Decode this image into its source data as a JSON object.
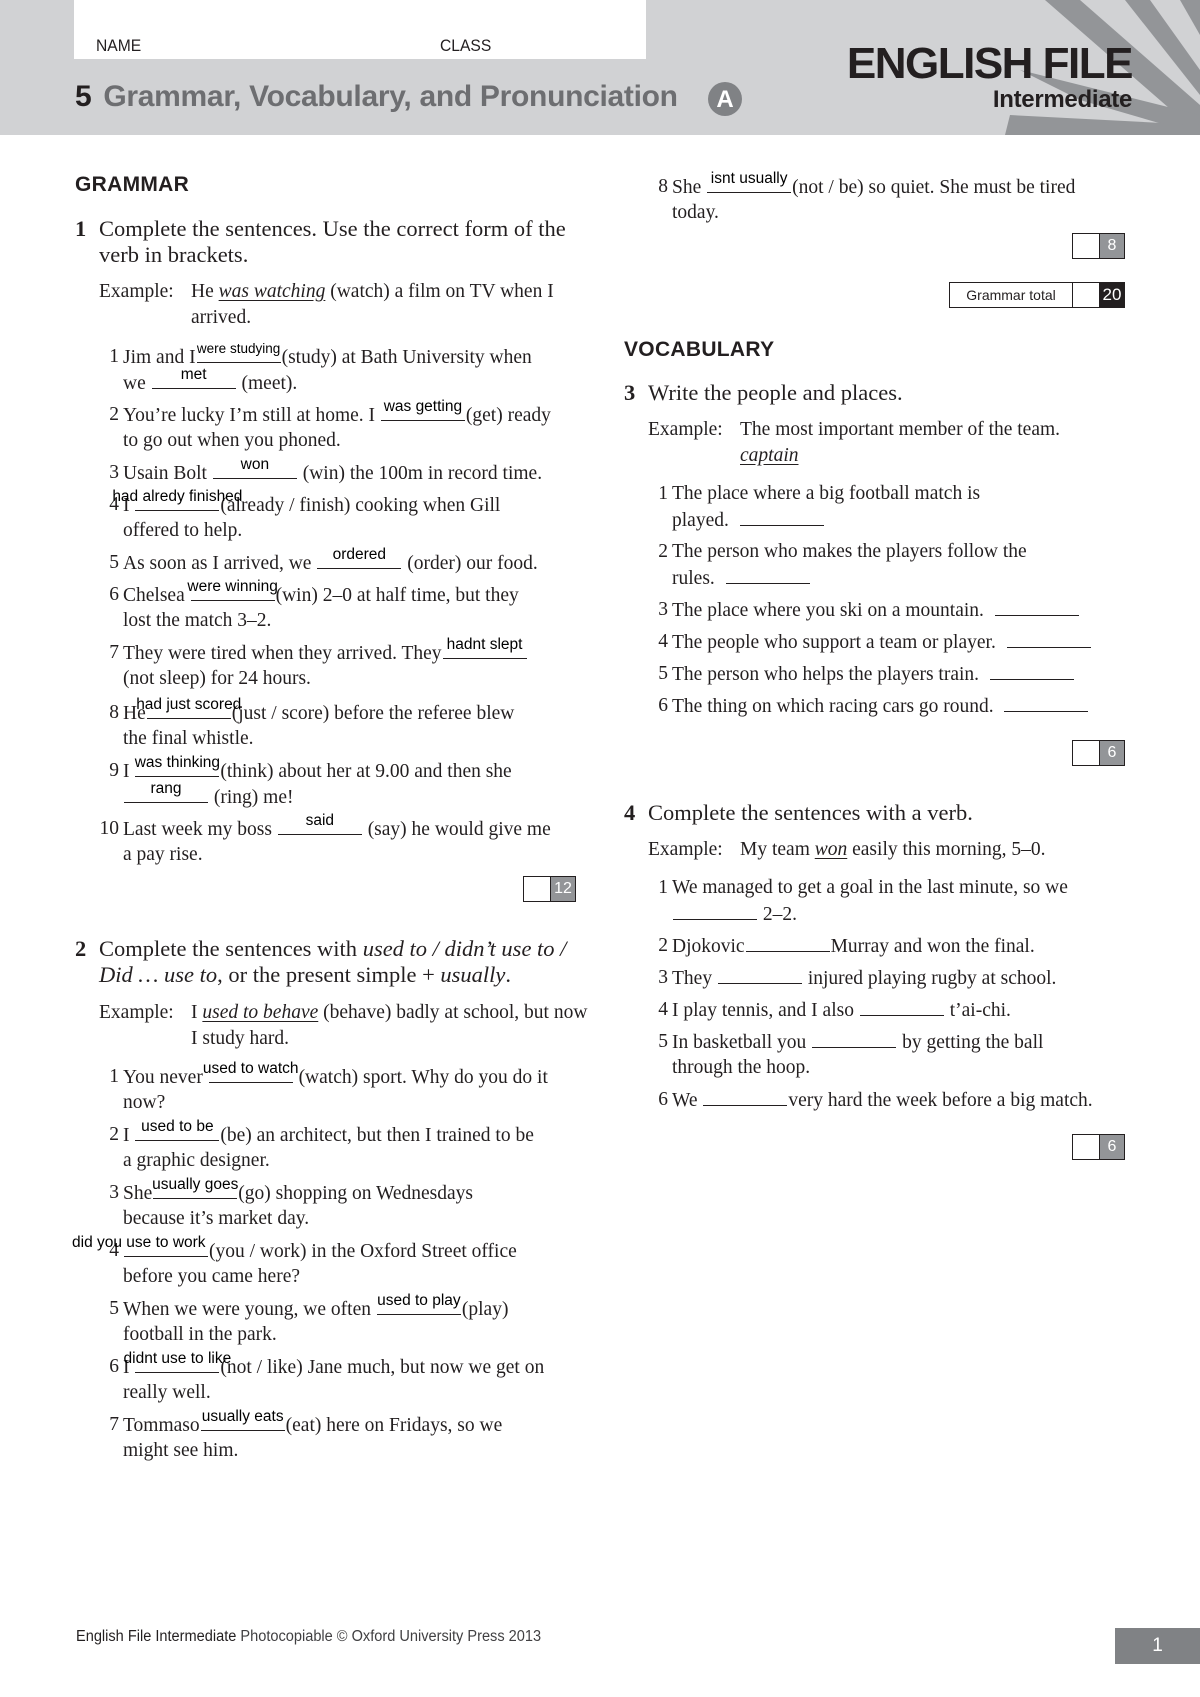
{
  "header": {
    "name_label": "NAME",
    "class_label": "CLASS",
    "unit_number": "5",
    "unit_title": "Grammar, Vocabulary, and Pronunciation",
    "version": "A",
    "brand": "ENGLISH FILE",
    "level": "Intermediate"
  },
  "grammar": {
    "heading": "GRAMMAR",
    "ex1": {
      "number": "1",
      "instruction": "Complete the sentences. Use the correct form of the verb in brackets.",
      "example_label": "Example:",
      "example_pre": "He ",
      "example_answer": "was watching",
      "example_post": " (watch) a film on TV when I arrived.",
      "items": [
        {
          "n": "1",
          "a": "Jim and I",
          "ans1": "were studying",
          "b": "(study) at Bath University when",
          "c": "we",
          "ans2": "met",
          "d": "(meet)."
        },
        {
          "n": "2",
          "a": "You’re lucky I’m still at home. I",
          "ans1": "was getting",
          "b": "(get) ready",
          "c": "to go out when you phoned."
        },
        {
          "n": "3",
          "a": "Usain Bolt",
          "ans1": "won",
          "b": "(win) the 100m in record time."
        },
        {
          "n": "4",
          "a": "I",
          "ans1": "had alredy finished",
          "b": "(already / finish) cooking when Gill",
          "c": "offered to help."
        },
        {
          "n": "5",
          "a": "As soon as I arrived, we",
          "ans1": "ordered",
          "b": "(order) our food."
        },
        {
          "n": "6",
          "a": "Chelsea",
          "ans1": "were winning",
          "b": "(win) 2–0 at half time, but they",
          "c": "lost the match 3–2."
        },
        {
          "n": "7",
          "a": "They were tired when they arrived. They",
          "ans1": "hadnt slept",
          "c": "(not sleep) for 24 hours."
        },
        {
          "n": "8",
          "a": "He",
          "ans1": "had just scored",
          "b": "(just / score) before the referee blew",
          "c": "the final whistle."
        },
        {
          "n": "9",
          "a": "I",
          "ans1": "was thinking",
          "b": "(think) about her at 9.00 and then she",
          "ans2": "rang",
          "d": "(ring) me!"
        },
        {
          "n": "10",
          "a": "Last week my boss",
          "ans1": "said",
          "b": "(say) he would give me",
          "c": "a pay rise."
        }
      ],
      "max_score": "12"
    },
    "ex2": {
      "number": "2",
      "instruction_pre": "Complete the sentences with ",
      "instruction_italic1": "used to / didn’t use to /",
      "instruction_italic2": "Did … use to",
      "instruction_mid": ", or the present simple + ",
      "instruction_italic3": "usually",
      "instruction_end": ".",
      "example_label": "Example:",
      "example_pre": "I ",
      "example_answer": "used to behave",
      "example_post": " (behave) badly at school, but now I study hard.",
      "items": [
        {
          "n": "1",
          "a": "You never",
          "ans1": "used to watch",
          "b": "(watch) sport. Why do you do it",
          "c": "now?"
        },
        {
          "n": "2",
          "a": "I",
          "ans1": "used to be",
          "b": "(be) an architect, but then I trained to be",
          "c": "a graphic designer."
        },
        {
          "n": "3",
          "a": "She",
          "ans1": "usually goes",
          "b": "(go) shopping on Wednesdays",
          "c": "because it’s market day."
        },
        {
          "n": "4",
          "ans1": "did you use to work",
          "b": "(you / work) in the Oxford Street office",
          "c": "before you came here?"
        },
        {
          "n": "5",
          "a": "When we were young, we often",
          "ans1": "used to play",
          "b": "(play)",
          "c": "football in the park."
        },
        {
          "n": "6",
          "a": "I",
          "ans1": "didnt use to like",
          "b": "(not / like) Jane much, but now we get on",
          "c": "really well."
        },
        {
          "n": "7",
          "a": "Tommaso",
          "ans1": "usually eats",
          "b": "(eat) here on Fridays, so we",
          "c": "might see him."
        },
        {
          "n": "8",
          "a": "She",
          "ans1": "isnt usually",
          "b": "(not / be) so quiet. She must be tired",
          "c": "today."
        }
      ],
      "max_score": "8"
    },
    "total_label": "Grammar total",
    "total_max": "20"
  },
  "vocabulary": {
    "heading": "VOCABULARY",
    "ex3": {
      "number": "3",
      "instruction": "Write the people and places.",
      "example_label": "Example:",
      "example_text": "The most important member of the team.",
      "example_answer": "captain",
      "items": [
        {
          "n": "1",
          "a": "The place where a big football match is",
          "c": "played."
        },
        {
          "n": "2",
          "a": "The person who makes the players follow the",
          "c": "rules."
        },
        {
          "n": "3",
          "a": "The place where you ski on a mountain."
        },
        {
          "n": "4",
          "a": "The people who support a team or player."
        },
        {
          "n": "5",
          "a": "The person who helps the players train."
        },
        {
          "n": "6",
          "a": "The thing on which racing cars go round."
        }
      ],
      "max_score": "6"
    },
    "ex4": {
      "number": "4",
      "instruction": "Complete the sentences with a verb.",
      "example_label": "Example:",
      "example_pre": "My team ",
      "example_answer": "won",
      "example_post": " easily this morning, 5–0.",
      "items": [
        {
          "n": "1",
          "a": "We managed to get a goal in the last minute, so we",
          "d": "2–2."
        },
        {
          "n": "2",
          "a": "Djokovic",
          "b": "Murray and won the final."
        },
        {
          "n": "3",
          "a": "They",
          "b": "injured playing rugby at school."
        },
        {
          "n": "4",
          "a": "I play tennis, and I also",
          "b": "t’ai-chi."
        },
        {
          "n": "5",
          "a": "In basketball you",
          "b": "by getting the ball",
          "c": "through the hoop."
        },
        {
          "n": "6",
          "a": "We",
          "b": "very hard the week before a big match."
        }
      ],
      "max_score": "6"
    }
  },
  "footer": {
    "book": "English File Intermediate",
    "rights": "Photocopiable © Oxford University Press 2013",
    "page": "1"
  }
}
